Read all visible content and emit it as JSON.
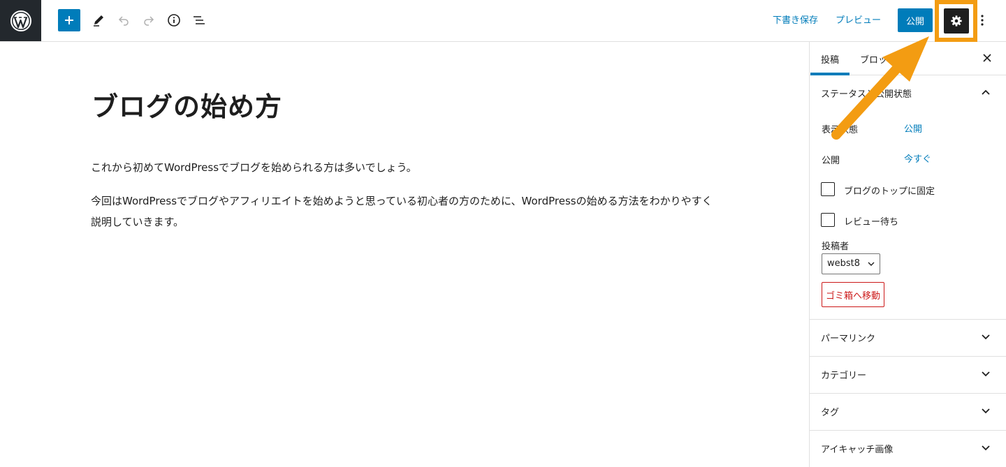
{
  "toolbar": {
    "save_draft_label": "下書き保存",
    "preview_label": "プレビュー",
    "publish_label": "公開"
  },
  "editor": {
    "title": "ブログの始め方",
    "paragraphs": [
      "これから初めてWordPressでブログを始められる方は多いでしょう。",
      "今回はWordPressでブログやアフィリエイトを始めようと思っている初心者の方のために、WordPressの始める方法をわかりやすく説明していきます。"
    ]
  },
  "sidebar": {
    "tabs": [
      {
        "label": "投稿"
      },
      {
        "label": "ブロック"
      }
    ],
    "status_panel": {
      "title": "ステータスと公開状態",
      "visibility_label": "表示状態",
      "visibility_value": "公開",
      "publish_label": "公開",
      "publish_value": "今すぐ",
      "sticky_label": "ブログのトップに固定",
      "pending_label": "レビュー待ち",
      "author_label": "投稿者",
      "author_value": "webst8",
      "trash_label": "ゴミ箱へ移動"
    },
    "panels": [
      {
        "title": "パーマリンク"
      },
      {
        "title": "カテゴリー"
      },
      {
        "title": "タグ"
      },
      {
        "title": "アイキャッチ画像"
      }
    ]
  },
  "colors": {
    "accent": "#007cba",
    "highlight": "#f39c12",
    "danger": "#cc1818",
    "logo_bg": "#23282d"
  }
}
